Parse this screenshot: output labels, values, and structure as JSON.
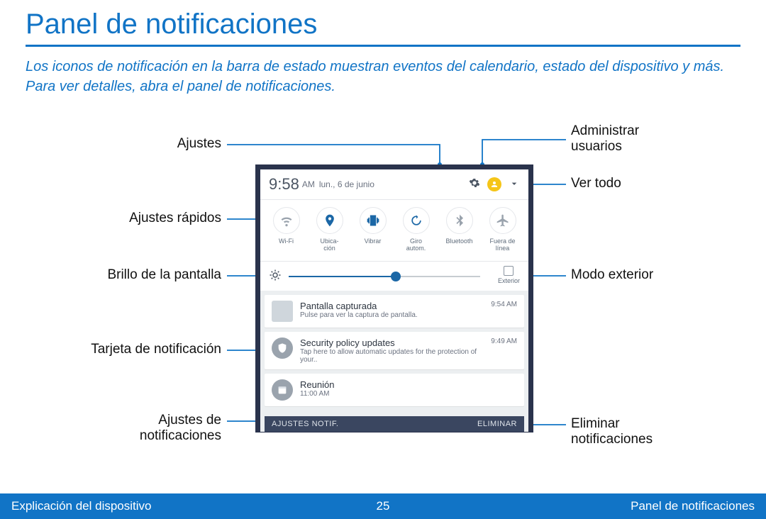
{
  "page": {
    "title": "Panel de notificaciones",
    "intro": "Los iconos de notificación en la barra de estado muestran eventos del calendario, estado del dispositivo y más. Para ver detalles, abra el panel de notificaciones."
  },
  "footer": {
    "left": "Explicación del dispositivo",
    "page_number": "25",
    "right": "Panel de notificaciones"
  },
  "callouts": {
    "ajustes": "Ajustes",
    "admin_usuarios": "Administrar\nusuarios",
    "ver_todo": "Ver todo",
    "ajustes_rapidos": "Ajustes rápidos",
    "brillo": "Brillo de la pantalla",
    "modo_exterior": "Modo exterior",
    "tarjeta": "Tarjeta de notificación",
    "ajustes_notif": "Ajustes de\nnotificaciones",
    "eliminar": "Eliminar\nnotificaciones"
  },
  "panel": {
    "clock": {
      "time": "9:58",
      "ampm": "AM",
      "date": "lun., 6 de junio"
    },
    "quick_settings": [
      {
        "id": "wifi",
        "label": "Wi-Fi"
      },
      {
        "id": "location",
        "label": "Ubica-\nción"
      },
      {
        "id": "vibrate",
        "label": "Vibrar"
      },
      {
        "id": "rotate",
        "label": "Giro\nautom."
      },
      {
        "id": "bluetooth",
        "label": "Bluetooth"
      },
      {
        "id": "airplane",
        "label": "Fuera de\nlínea"
      }
    ],
    "brightness": {
      "exterior_label": "Exterior"
    },
    "notifications": [
      {
        "icon": "screenshot",
        "title": "Pantalla capturada",
        "subtitle": "Pulse para ver la captura de pantalla.",
        "time": "9:54 AM"
      },
      {
        "icon": "shield",
        "title": "Security policy updates",
        "subtitle": "Tap here to allow automatic updates for the protection of your..",
        "time": "9:49 AM"
      },
      {
        "icon": "calendar",
        "title": "Reunión",
        "subtitle": "11:00 AM",
        "time": ""
      }
    ],
    "bottombar": {
      "left": "AJUSTES NOTIF.",
      "right": "ELIMINAR"
    }
  }
}
